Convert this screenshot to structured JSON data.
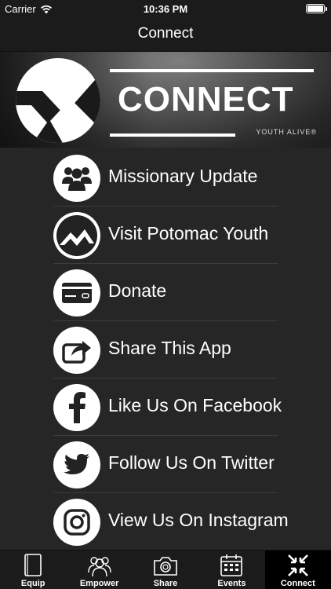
{
  "status_bar": {
    "carrier": "Carrier",
    "time": "10:36 PM"
  },
  "nav": {
    "title": "Connect"
  },
  "banner": {
    "title": "CONNECT",
    "subtitle": "YOUTH ALIVE®"
  },
  "menu": [
    {
      "label": "Missionary Update",
      "icon": "people-icon"
    },
    {
      "label": "Visit Potomac Youth",
      "icon": "mountain-logo-icon"
    },
    {
      "label": "Donate",
      "icon": "credit-card-icon"
    },
    {
      "label": "Share This App",
      "icon": "share-icon"
    },
    {
      "label": "Like Us On Facebook",
      "icon": "facebook-icon"
    },
    {
      "label": "Follow Us On Twitter",
      "icon": "twitter-icon"
    },
    {
      "label": "View Us On Instagram",
      "icon": "instagram-icon"
    }
  ],
  "tabs": [
    {
      "label": "Equip",
      "icon": "book-icon"
    },
    {
      "label": "Empower",
      "icon": "group-icon"
    },
    {
      "label": "Share",
      "icon": "camera-icon"
    },
    {
      "label": "Events",
      "icon": "calendar-icon"
    },
    {
      "label": "Connect",
      "icon": "arrows-inward-icon",
      "active": true
    }
  ],
  "colors": {
    "background": "#262626",
    "bar": "#1b1b1b",
    "divider": "#3c3c3c",
    "icon_bg": "#ffffff",
    "text": "#ffffff"
  }
}
